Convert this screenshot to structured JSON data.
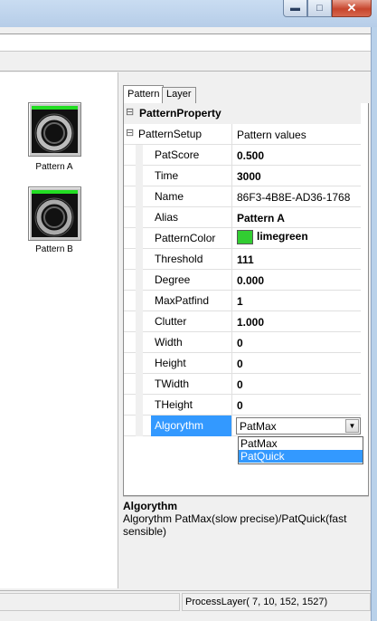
{
  "window": {
    "minimize_icon": "minimize-icon",
    "maximize_icon": "maximize-icon",
    "close_icon": "close-icon"
  },
  "left_panel": {
    "patterns": [
      {
        "label": "Pattern A",
        "marker_color": "#22dd22"
      },
      {
        "label": "Pattern B",
        "marker_color": "#22dd22"
      }
    ]
  },
  "tabs": [
    {
      "label": "Pattern"
    },
    {
      "label": "Layer"
    }
  ],
  "property_grid": {
    "category": "PatternProperty",
    "setup": {
      "name": "PatternSetup",
      "value": "Pattern values"
    },
    "rows": [
      {
        "name": "PatScore",
        "value": "0.500"
      },
      {
        "name": "Time",
        "value": "3000"
      },
      {
        "name": "Name",
        "value": "86F3-4B8E-AD36-1768"
      },
      {
        "name": "Alias",
        "value": "Pattern A"
      },
      {
        "name": "PatternColor",
        "value": "limegreen",
        "color": "#32cd32"
      },
      {
        "name": "Threshold",
        "value": "111"
      },
      {
        "name": "Degree",
        "value": "0.000"
      },
      {
        "name": "MaxPatfind",
        "value": "1"
      },
      {
        "name": "Clutter",
        "value": "1.000"
      },
      {
        "name": "Width",
        "value": "0"
      },
      {
        "name": "Height",
        "value": "0"
      },
      {
        "name": "TWidth",
        "value": "0"
      },
      {
        "name": "THeight",
        "value": "0"
      }
    ],
    "selected_row": {
      "name": "Algorythm",
      "value": "PatMax"
    },
    "dropdown_options": [
      {
        "label": "PatMax"
      },
      {
        "label": "PatQuick"
      }
    ]
  },
  "description": {
    "title": "Algorythm",
    "text": "Algorythm PatMax(slow precise)/PatQuick(fast sensible)"
  },
  "status": {
    "text": "ProcessLayer( 7, 10, 152, 1527)"
  },
  "colors": {
    "selection": "#3399ff",
    "pattern_marker": "#22dd22",
    "swatch": "#32cd32"
  }
}
